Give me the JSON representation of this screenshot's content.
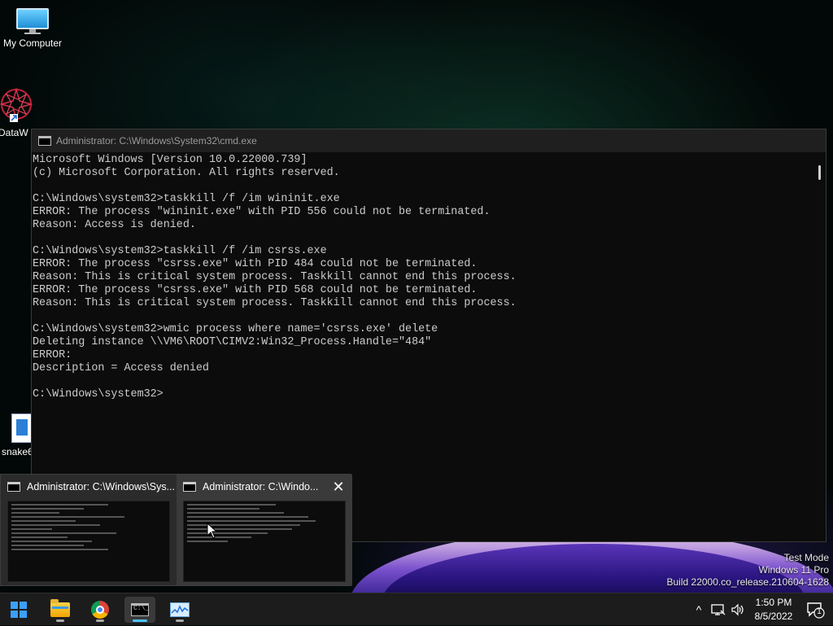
{
  "desktop": {
    "icons": [
      {
        "label": "My Computer",
        "icon": "monitor-icon"
      },
      {
        "label": "DataW",
        "icon": "datawatch-icon"
      },
      {
        "label": "snake6",
        "icon": "file-icon"
      }
    ]
  },
  "cmd_window": {
    "title": "Administrator: C:\\Windows\\System32\\cmd.exe",
    "lines": [
      "Microsoft Windows [Version 10.0.22000.739]",
      "(c) Microsoft Corporation. All rights reserved.",
      "",
      "C:\\Windows\\system32>taskkill /f /im wininit.exe",
      "ERROR: The process \"wininit.exe\" with PID 556 could not be terminated.",
      "Reason: Access is denied.",
      "",
      "C:\\Windows\\system32>taskkill /f /im csrss.exe",
      "ERROR: The process \"csrss.exe\" with PID 484 could not be terminated.",
      "Reason: This is critical system process. Taskkill cannot end this process.",
      "ERROR: The process \"csrss.exe\" with PID 568 could not be terminated.",
      "Reason: This is critical system process. Taskkill cannot end this process.",
      "",
      "C:\\Windows\\system32>wmic process where name='csrss.exe' delete",
      "Deleting instance \\\\VM6\\ROOT\\CIMV2:Win32_Process.Handle=\"484\"",
      "ERROR:",
      "Description = Access denied",
      "",
      "C:\\Windows\\system32>"
    ]
  },
  "thumbnails": [
    {
      "title": "Administrator: C:\\Windows\\Sys...",
      "active": false
    },
    {
      "title": "Administrator: C:\\Windo...",
      "active": true,
      "close_glyph": "✕"
    }
  ],
  "watermark": {
    "line1": "Test Mode",
    "line2": "Windows 11 Pro",
    "line3": "Build 22000.co_release.210604-1628"
  },
  "taskbar": {
    "apps": [
      "start-icon",
      "file-explorer-icon",
      "chrome-icon",
      "cmd-icon",
      "performance-monitor-icon"
    ],
    "clock_time": "1:50 PM",
    "clock_date": "8/5/2022",
    "tray_chevron": "^",
    "notification_count": "1"
  }
}
